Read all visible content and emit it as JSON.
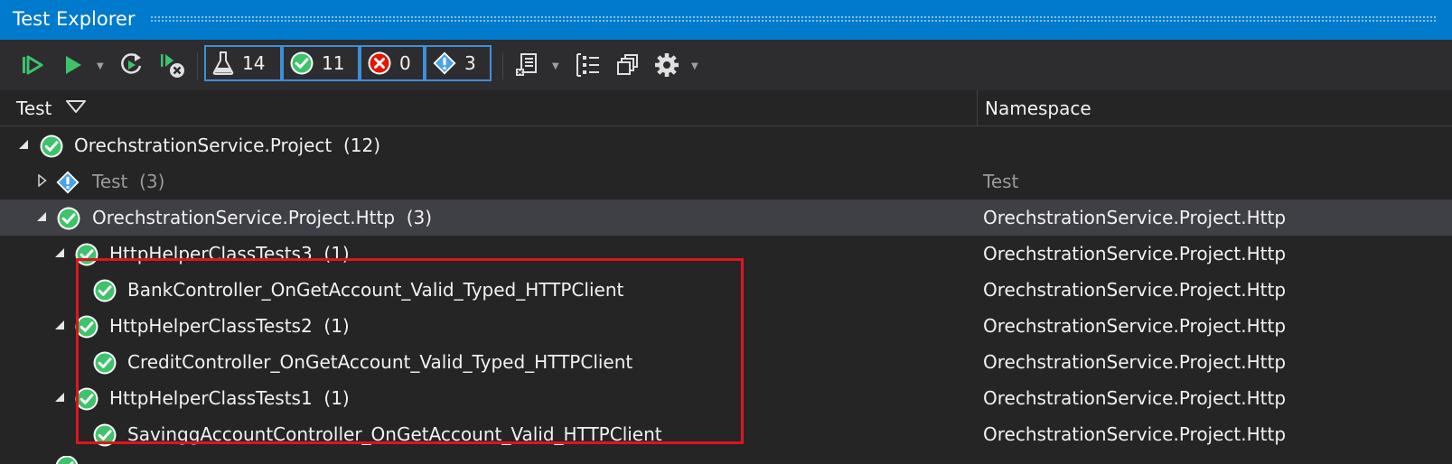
{
  "window": {
    "title": "Test Explorer"
  },
  "toolbar": {
    "counters": {
      "total": "14",
      "passed": "11",
      "failed": "0",
      "skipped": "3"
    }
  },
  "columns": {
    "test": "Test",
    "namespace": "Namespace"
  },
  "rows": [
    {
      "name": "OrechstrationService.Project",
      "count": "(12)",
      "namespace": ""
    },
    {
      "name": "Test",
      "count": "(3)",
      "namespace": "Test"
    },
    {
      "name": "OrechstrationService.Project.Http",
      "count": "(3)",
      "namespace": "OrechstrationService.Project.Http"
    },
    {
      "name": "HttpHelperClassTests3",
      "count": "(1)",
      "namespace": "OrechstrationService.Project.Http"
    },
    {
      "name": "BankController_OnGetAccount_Valid_Typed_HTTPClient",
      "count": "",
      "namespace": "OrechstrationService.Project.Http"
    },
    {
      "name": "HttpHelperClassTests2",
      "count": "(1)",
      "namespace": "OrechstrationService.Project.Http"
    },
    {
      "name": "CreditController_OnGetAccount_Valid_Typed_HTTPClient",
      "count": "",
      "namespace": "OrechstrationService.Project.Http"
    },
    {
      "name": "HttpHelperClassTests1",
      "count": "(1)",
      "namespace": "OrechstrationService.Project.Http"
    },
    {
      "name": "SavinggAccountController_OnGetAccount_Valid_HTTPClient",
      "count": "",
      "namespace": "OrechstrationService.Project.Http"
    }
  ],
  "colors": {
    "title_bar": "#007acc",
    "passed": "#3ec36b",
    "failed": "#e51400",
    "skipped": "#1e88e5",
    "highlight": "#e0141e"
  }
}
